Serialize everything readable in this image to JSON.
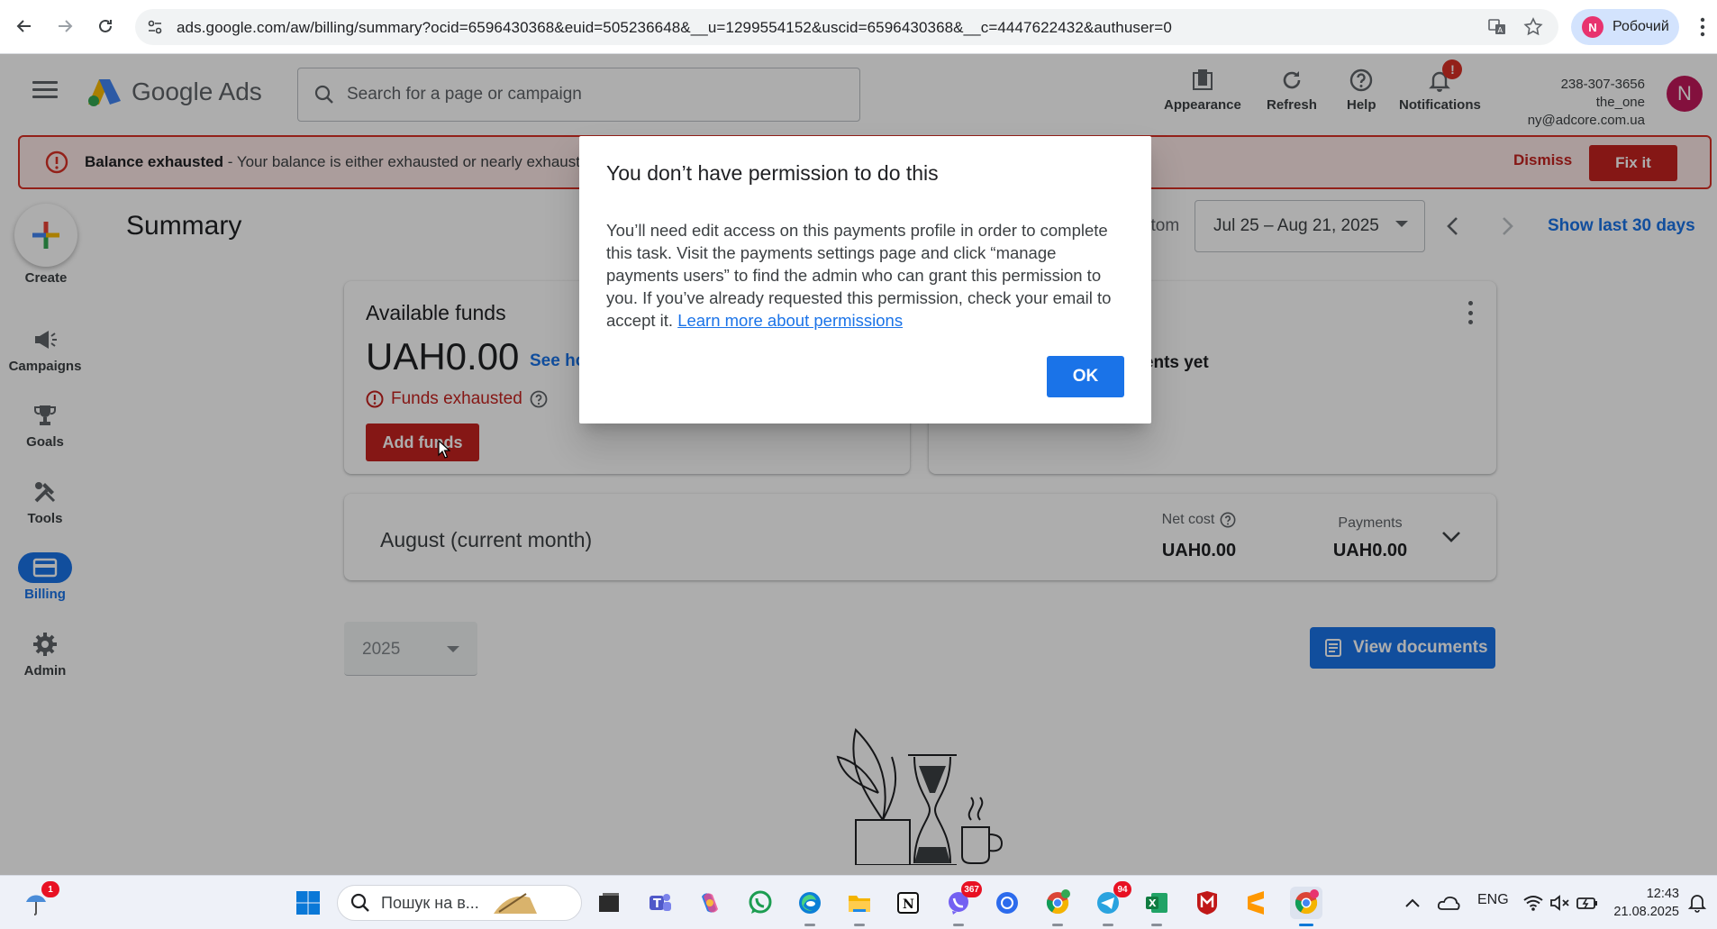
{
  "browser": {
    "url": "ads.google.com/aw/billing/summary?ocid=6596430368&euid=505236648&__u=1299554152&uscid=6596430368&__c=4447622432&authuser=0",
    "profile_initial": "N",
    "profile_name": "Робочий"
  },
  "header": {
    "app_name": "Google Ads",
    "search_placeholder": "Search for a page or campaign",
    "tools": [
      "Appearance",
      "Refresh",
      "Help",
      "Notifications"
    ],
    "notification_badge": "!",
    "account_id": "238-307-3656 the_one",
    "account_email": "ny@adcore.com.ua",
    "avatar_initial": "N"
  },
  "banner": {
    "title": "Balance exhausted",
    "message": " - Your balance is either exhausted or nearly exhausted. T",
    "dismiss_label": "Dismiss",
    "fix_label": "Fix it",
    "accent_color": "#d93025"
  },
  "nav": {
    "create_label": "Create",
    "items": [
      "Campaigns",
      "Goals",
      "Tools",
      "Billing",
      "Admin"
    ],
    "active": "Billing"
  },
  "main": {
    "title": "Summary",
    "date_prefix": "stom",
    "date_range": "Jul 25 – Aug 21, 2025",
    "show_last_label": "Show last 30 days",
    "funds_card": {
      "title": "Available funds",
      "amount": "UAH0.00",
      "link_text": "See ho",
      "status": "Funds exhausted",
      "button_label": "Add funds"
    },
    "payments_card": {
      "text": "ments yet"
    },
    "month_card": {
      "title": "August (current month)",
      "net_cost_label": "Net cost",
      "net_cost_value": "UAH0.00",
      "payments_label": "Payments",
      "payments_value": "UAH0.00"
    },
    "year": "2025",
    "view_documents_label": "View documents"
  },
  "dialog": {
    "title": "You don’t have permission to do this",
    "body": "You’ll need edit access on this payments profile in order to complete this task. Visit the payments settings page and click “manage payments users” to find the admin who can grant this permission to you. If you’ve already requested this permission, check your email to accept it. ",
    "link_text": "Learn more about permissions",
    "ok_label": "OK"
  },
  "taskbar": {
    "weather_badge": "1",
    "search_placeholder": "Пошук на в...",
    "viber_badge": "367",
    "telegram_badge": "94",
    "language": "ENG",
    "time": "12:43",
    "date": "21.08.2025"
  }
}
